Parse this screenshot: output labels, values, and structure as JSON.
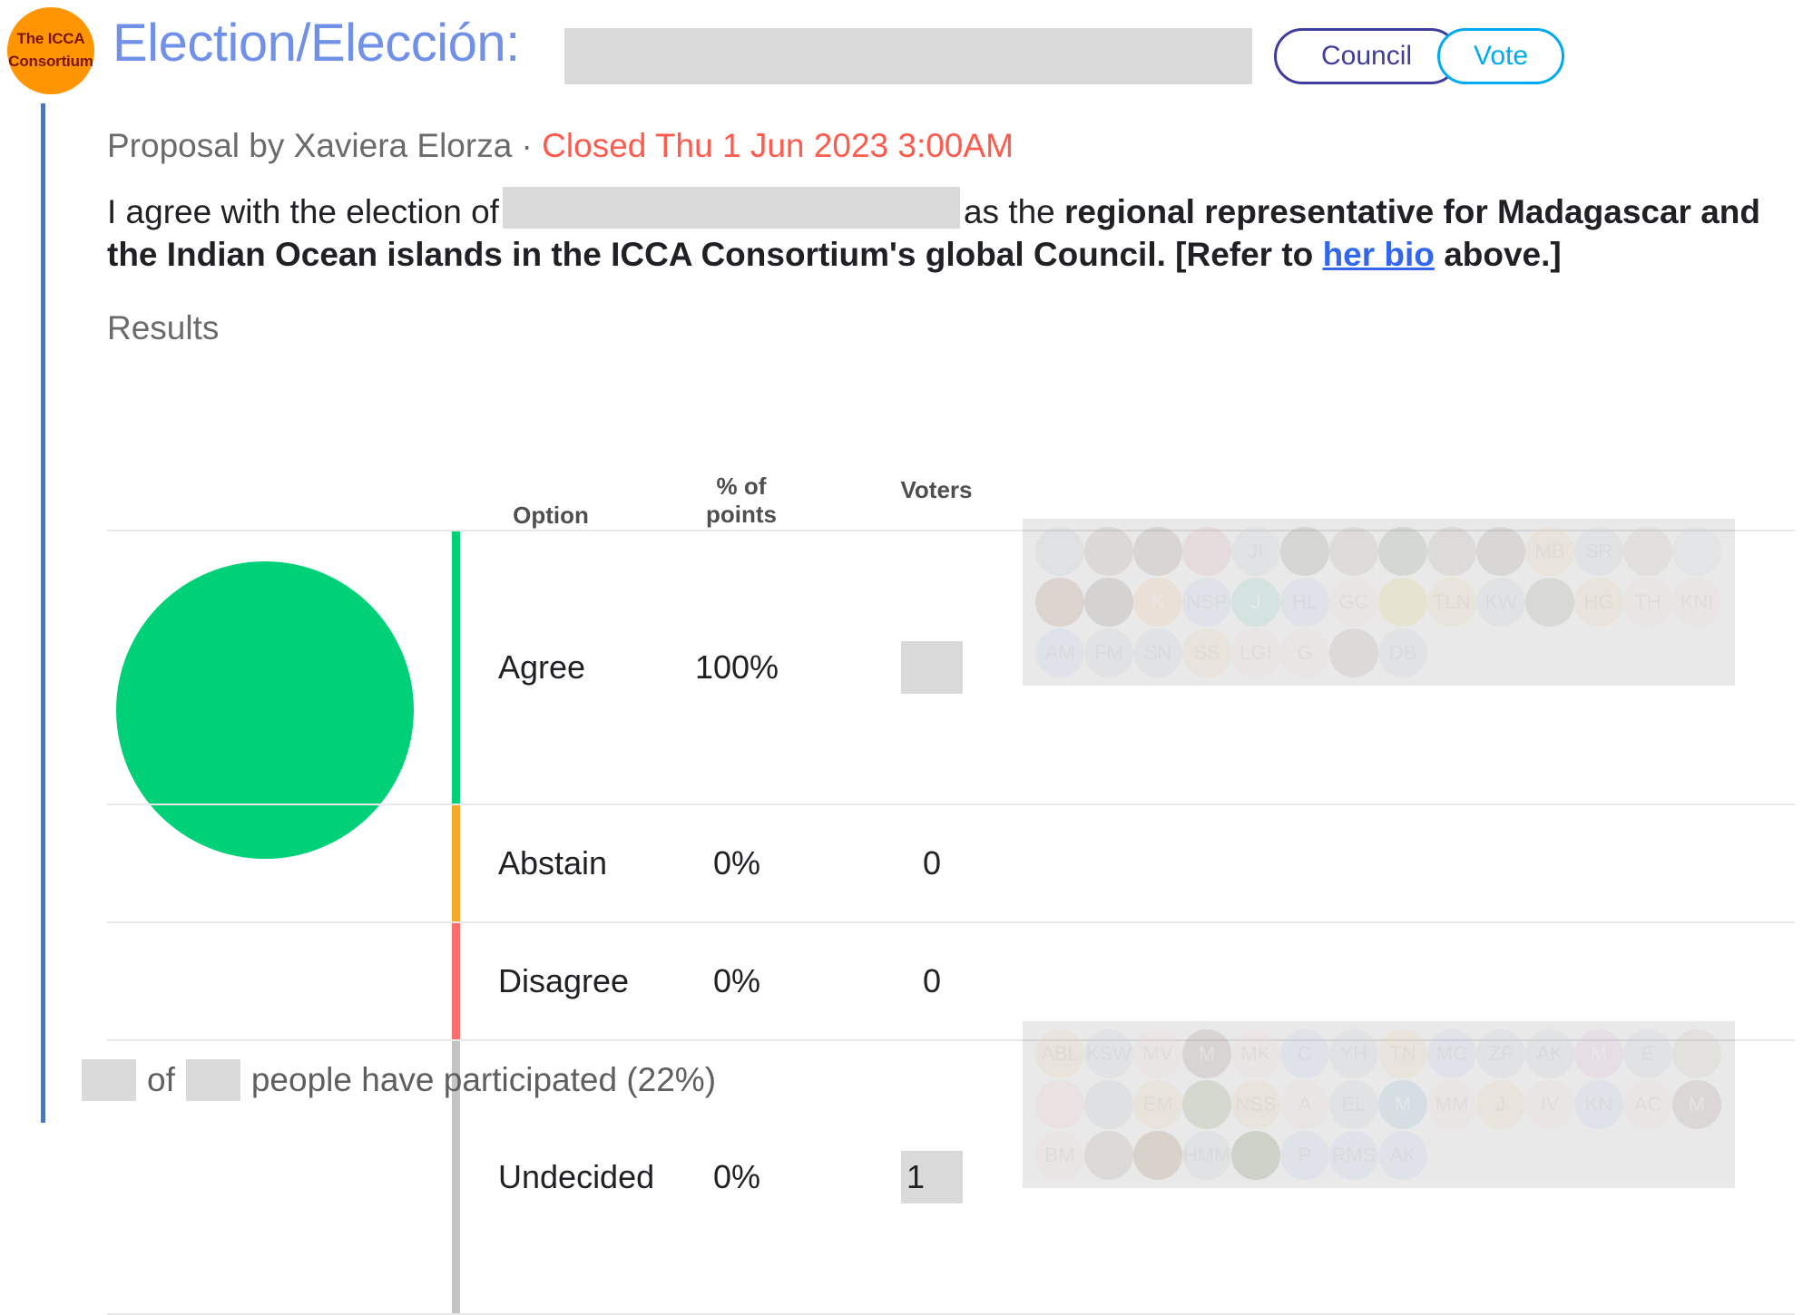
{
  "header": {
    "logo": {
      "line1": "The ICCA",
      "line2": "Consortium",
      "bg_color": "#FF9500",
      "text_color": "#7B1500"
    },
    "title": "Election/Elección:",
    "title_redacted": true,
    "council_label": "Council",
    "vote_label": "Vote",
    "council_color": "#3F3D9E",
    "vote_color": "#00AAF0",
    "title_color": "#7190E8"
  },
  "proposal": {
    "byline_prefix": "Proposal by Xaviera Elorza · ",
    "status": "Closed Thu 1 Jun 2023 3:00AM",
    "status_color": "#FF5A4E",
    "text_part1": "I agree with the election of",
    "name_redacted": true,
    "text_part2": "as the",
    "bold_part1": "regional representative for Madagascar and the Indian Ocean islands in the ICCA Consortium's global Council. [Refer to",
    "link_text": "her bio",
    "bold_part2": "above.]"
  },
  "results": {
    "section_label": "Results",
    "columns": [
      "Option",
      "% of points",
      "Voters"
    ],
    "column_option": "Option",
    "column_points_line1": "% of",
    "column_points_line2": "points",
    "column_voters": "Voters",
    "rows": [
      {
        "option": "Agree",
        "percent": "100%",
        "voters": "",
        "voters_redacted": true,
        "color": "#00D179",
        "has_avatars": true
      },
      {
        "option": "Abstain",
        "percent": "0%",
        "voters": "0",
        "voters_redacted": false,
        "color": "#F7A928",
        "has_avatars": false
      },
      {
        "option": "Disagree",
        "percent": "0%",
        "voters": "0",
        "voters_redacted": false,
        "color": "#FA6E6E",
        "has_avatars": false
      },
      {
        "option": "Undecided",
        "percent": "0%",
        "voters": "1",
        "voters_redacted": true,
        "color": "#C4C4C4",
        "has_avatars": true
      }
    ]
  },
  "chart_data": {
    "type": "pie",
    "title": "Results",
    "categories": [
      "Agree",
      "Abstain",
      "Disagree",
      "Undecided"
    ],
    "values": [
      100,
      0,
      0,
      0
    ],
    "value_unit": "% of points",
    "colors": [
      "#00D179",
      "#F7A928",
      "#FA6E6E",
      "#C4C4C4"
    ],
    "legend": "table",
    "grid": false
  },
  "agree_avatars": [
    {
      "initials": "",
      "photo": true,
      "bg": "#b9c4cc"
    },
    {
      "initials": "",
      "photo": true,
      "bg": "#a89a93"
    },
    {
      "initials": "",
      "photo": true,
      "bg": "#9a8d85"
    },
    {
      "initials": "",
      "photo": true,
      "bg": "#d8a8b0"
    },
    {
      "initials": "JI",
      "photo": false,
      "bg": "#c3ccd4"
    },
    {
      "initials": "",
      "photo": true,
      "bg": "#8f8d88"
    },
    {
      "initials": "",
      "photo": true,
      "bg": "#b6ae9e"
    },
    {
      "initials": "",
      "photo": true,
      "bg": "#8f9a80"
    },
    {
      "initials": "",
      "photo": true,
      "bg": "#b0a8a2"
    },
    {
      "initials": "",
      "photo": true,
      "bg": "#9b958f"
    },
    {
      "initials": "MB",
      "photo": false,
      "bg": "#e8d3ab"
    },
    {
      "initials": "SR",
      "photo": false,
      "bg": "#c3ccd4"
    },
    {
      "initials": "",
      "photo": true,
      "bg": "#c7bdb0"
    },
    {
      "initials": "",
      "photo": true,
      "bg": "#cfd3d6"
    },
    {
      "initials": "",
      "photo": true,
      "bg": "#b08a78"
    },
    {
      "initials": "",
      "photo": true,
      "bg": "#8e857c"
    },
    {
      "initials": "K",
      "photo": false,
      "bg": "#f2c49a",
      "dark": true
    },
    {
      "initials": "NSP",
      "photo": false,
      "bg": "#c0cbe8"
    },
    {
      "initials": "J",
      "photo": false,
      "bg": "#8fd2c4",
      "dark": true
    },
    {
      "initials": "HL",
      "photo": false,
      "bg": "#c0cbe8"
    },
    {
      "initials": "GC",
      "photo": false,
      "bg": "#f0d8d8"
    },
    {
      "initials": "",
      "photo": true,
      "bg": "#d9d07a"
    },
    {
      "initials": "TLN",
      "photo": false,
      "bg": "#e8d3ab"
    },
    {
      "initials": "KW",
      "photo": false,
      "bg": "#c3ccd4"
    },
    {
      "initials": "",
      "photo": true,
      "bg": "#9a9a8c"
    },
    {
      "initials": "HG",
      "photo": false,
      "bg": "#e8d3ab"
    },
    {
      "initials": "TH",
      "photo": false,
      "bg": "#f0d8d8"
    },
    {
      "initials": "KNI",
      "photo": false,
      "bg": "#f0d8d8"
    },
    {
      "initials": "AM",
      "photo": false,
      "bg": "#c0cbe8"
    },
    {
      "initials": "FM",
      "photo": false,
      "bg": "#c3ccd4"
    },
    {
      "initials": "SN",
      "photo": false,
      "bg": "#c3ccd4"
    },
    {
      "initials": "SS",
      "photo": false,
      "bg": "#e8d3ab"
    },
    {
      "initials": "LGI",
      "photo": false,
      "bg": "#f0d8d8"
    },
    {
      "initials": "G",
      "photo": false,
      "bg": "#f0d8d8"
    },
    {
      "initials": "",
      "photo": true,
      "bg": "#a9a39c"
    },
    {
      "initials": "DB",
      "photo": false,
      "bg": "#c3ccd4"
    }
  ],
  "undecided_avatars": [
    {
      "initials": "ABL",
      "photo": false,
      "bg": "#e8d3ab"
    },
    {
      "initials": "KSW",
      "photo": false,
      "bg": "#c3ccd4"
    },
    {
      "initials": "MV",
      "photo": false,
      "bg": "#f0d8d8"
    },
    {
      "initials": "M",
      "photo": false,
      "bg": "#9b8e8a",
      "dark": true
    },
    {
      "initials": "MK",
      "photo": false,
      "bg": "#f0d8d8"
    },
    {
      "initials": "C",
      "photo": false,
      "bg": "#c0cbe8"
    },
    {
      "initials": "YH",
      "photo": false,
      "bg": "#c3ccd4"
    },
    {
      "initials": "TN",
      "photo": false,
      "bg": "#e8d3ab"
    },
    {
      "initials": "MC",
      "photo": false,
      "bg": "#c0cbe8"
    },
    {
      "initials": "ZF",
      "photo": false,
      "bg": "#c3ccd4"
    },
    {
      "initials": "AK",
      "photo": false,
      "bg": "#c3ccd4"
    },
    {
      "initials": "M",
      "photo": false,
      "bg": "#d9bcd8",
      "dark": true
    },
    {
      "initials": "E",
      "photo": false,
      "bg": "#c3ccd4"
    },
    {
      "initials": "",
      "photo": true,
      "bg": "#cfc5b6"
    },
    {
      "initials": "",
      "photo": true,
      "bg": "#eec7c7"
    },
    {
      "initials": "",
      "photo": true,
      "bg": "#b5bfc4"
    },
    {
      "initials": "EM",
      "photo": false,
      "bg": "#e8d3ab"
    },
    {
      "initials": "",
      "photo": true,
      "bg": "#8d9a72"
    },
    {
      "initials": "NSS",
      "photo": false,
      "bg": "#e8d3ab"
    },
    {
      "initials": "A",
      "photo": false,
      "bg": "#f0d8d8"
    },
    {
      "initials": "EL",
      "photo": false,
      "bg": "#c3ccd4"
    },
    {
      "initials": "M",
      "photo": false,
      "bg": "#93bdd2",
      "dark": true
    },
    {
      "initials": "MM",
      "photo": false,
      "bg": "#f0d8d8"
    },
    {
      "initials": "J",
      "photo": false,
      "bg": "#e8d3ab"
    },
    {
      "initials": "IV",
      "photo": false,
      "bg": "#f0d8d8"
    },
    {
      "initials": "KN",
      "photo": false,
      "bg": "#c0cbe8"
    },
    {
      "initials": "AC",
      "photo": false,
      "bg": "#f0d8d8"
    },
    {
      "initials": "M",
      "photo": false,
      "bg": "#a99b96",
      "dark": true
    },
    {
      "initials": "BM",
      "photo": false,
      "bg": "#f0d8d8"
    },
    {
      "initials": "",
      "photo": true,
      "bg": "#a8a39c"
    },
    {
      "initials": "",
      "photo": true,
      "bg": "#9b7f5c"
    },
    {
      "initials": "HMM",
      "photo": false,
      "bg": "#c3ccd4"
    },
    {
      "initials": "",
      "photo": true,
      "bg": "#6f7a52"
    },
    {
      "initials": "P",
      "photo": false,
      "bg": "#c0cbe8"
    },
    {
      "initials": "RMS",
      "photo": false,
      "bg": "#c0cbe8"
    },
    {
      "initials": "AK",
      "photo": false,
      "bg": "#c0cbe8"
    }
  ],
  "footer": {
    "count_redacted": true,
    "of_label": "of",
    "total_redacted": true,
    "text": "people have participated (22%)"
  }
}
